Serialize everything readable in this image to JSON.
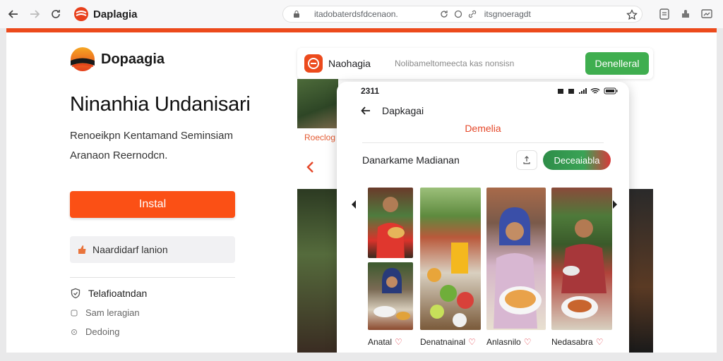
{
  "browser": {
    "tab_title": "Daplagia",
    "url_text": "itadobaterdsfdcenaon.",
    "url_text_2": "itsgnoeragdt",
    "accent_color": "#ec4a1c"
  },
  "hero": {
    "brand_name": "Dopaagia",
    "headline": "Ninanhia Undanisari",
    "desc_line1": "Renoeikpn Kentamand Seminsiam",
    "desc_line2": "Aranaon Reernodcn.",
    "install_label": "Instal",
    "secondary_label": "Naardidarf lanion",
    "feature_label": "Telafioatndan",
    "sub_items": [
      "Sam leragian",
      "Dedoing"
    ]
  },
  "listing": {
    "name": "Naohagia",
    "search_text": "Nolibameltomeecta kas nonsisn",
    "action_label": "Denelleral",
    "photo_label": "Roeclog"
  },
  "phone": {
    "time": "2311",
    "title": "Dapkagai",
    "subtitle": "Demelia",
    "row_label": "Danarkame Madianan",
    "row_button": "Deceaiabla",
    "captions": [
      "Anatal",
      "Denatnainal",
      "Anlasnilo",
      "Nedasabra"
    ]
  },
  "colors": {
    "install": "#fb5015",
    "green": "#3fae4f",
    "red": "#e5482a"
  }
}
